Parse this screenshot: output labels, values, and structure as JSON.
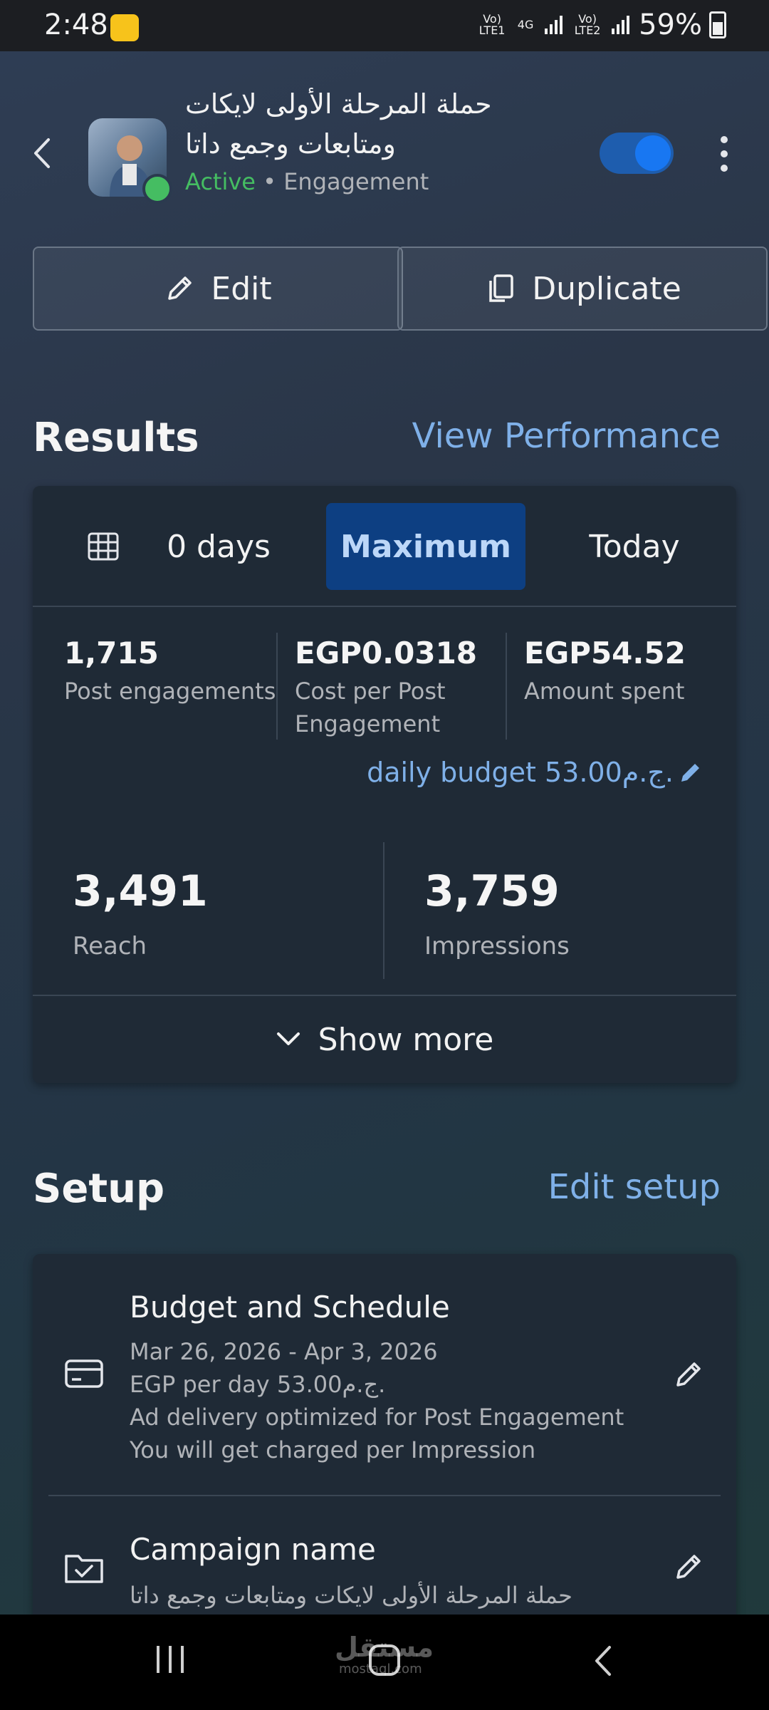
{
  "status_bar": {
    "time": "2:48",
    "net1": "Vo) LTE1",
    "net_type": "4G",
    "net2": "Vo) LTE2",
    "battery": "59%"
  },
  "header": {
    "title": "حملة المرحلة الأولى لايكات ومتابعات وجمع داتا",
    "status": "Active",
    "separator": "•",
    "objective": "Engagement",
    "toggle_on": true
  },
  "actions": {
    "edit_label": "Edit",
    "duplicate_label": "Duplicate"
  },
  "results": {
    "title": "Results",
    "link": "View Performance",
    "date_label": "0 days",
    "tabs": [
      "Maximum",
      "Today"
    ],
    "selected_tab": "Maximum",
    "metrics": [
      {
        "value": "1,715",
        "label": "Post engagements"
      },
      {
        "value": "EGP0.0318",
        "label": "Cost per Post Engagement"
      },
      {
        "value": "EGP54.52",
        "label": "Amount spent"
      }
    ],
    "daily_budget": "daily budget 53.00ج.م.",
    "reach_value": "3,491",
    "reach_label": "Reach",
    "impressions_value": "3,759",
    "impressions_label": "Impressions",
    "show_more": "Show more"
  },
  "setup": {
    "title": "Setup",
    "link": "Edit setup",
    "budget_title": "Budget and Schedule",
    "budget_dates": "Mar 26, 2026 - Apr 3, 2026",
    "budget_amount": "EGP per day 53.00ج.م.",
    "budget_optimization": "Ad delivery optimized for Post Engagement",
    "budget_charge": "You will get charged per Impression",
    "campaign_title": "Campaign name",
    "campaign_value": "حملة المرحلة الأولى لايكات ومتابعات وجمع داتا"
  },
  "watermark": {
    "text": "مستقل",
    "sub": "mostaql.com"
  },
  "colors": {
    "accent": "#1877f2",
    "link": "#7fb0e8",
    "active": "#45bd62",
    "card": "#1f2a36"
  }
}
